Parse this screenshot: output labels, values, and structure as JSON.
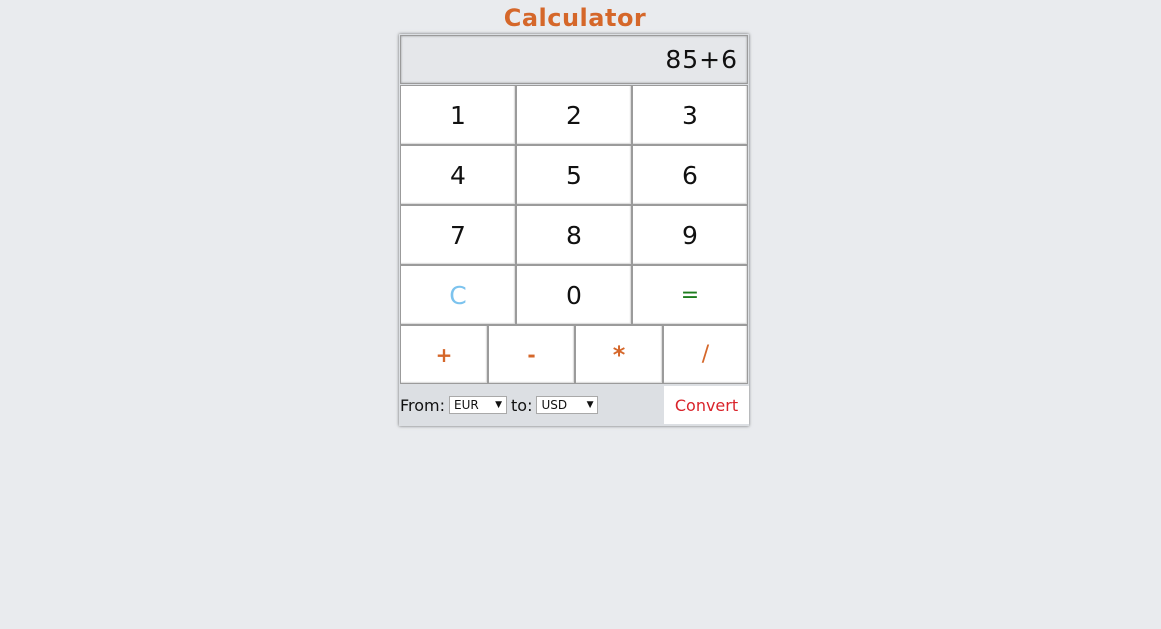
{
  "app": {
    "title": "Calculator"
  },
  "display": {
    "value": "85+6"
  },
  "keypad": {
    "row1": [
      "1",
      "2",
      "3"
    ],
    "row2": [
      "4",
      "5",
      "6"
    ],
    "row3": [
      "7",
      "8",
      "9"
    ],
    "row4": [
      "C",
      "0",
      "="
    ],
    "operators": [
      "+",
      "-",
      "*",
      "/"
    ]
  },
  "converter": {
    "from_label": "From:",
    "from_value": "EUR",
    "to_label": "to:",
    "to_value": "USD",
    "convert_label": "Convert"
  },
  "colors": {
    "title": "#d5672a",
    "clear": "#7cc3ee",
    "equals": "#1e7d1e",
    "operator": "#d5672a",
    "convert": "#d9232a",
    "background": "#e9ebee"
  }
}
